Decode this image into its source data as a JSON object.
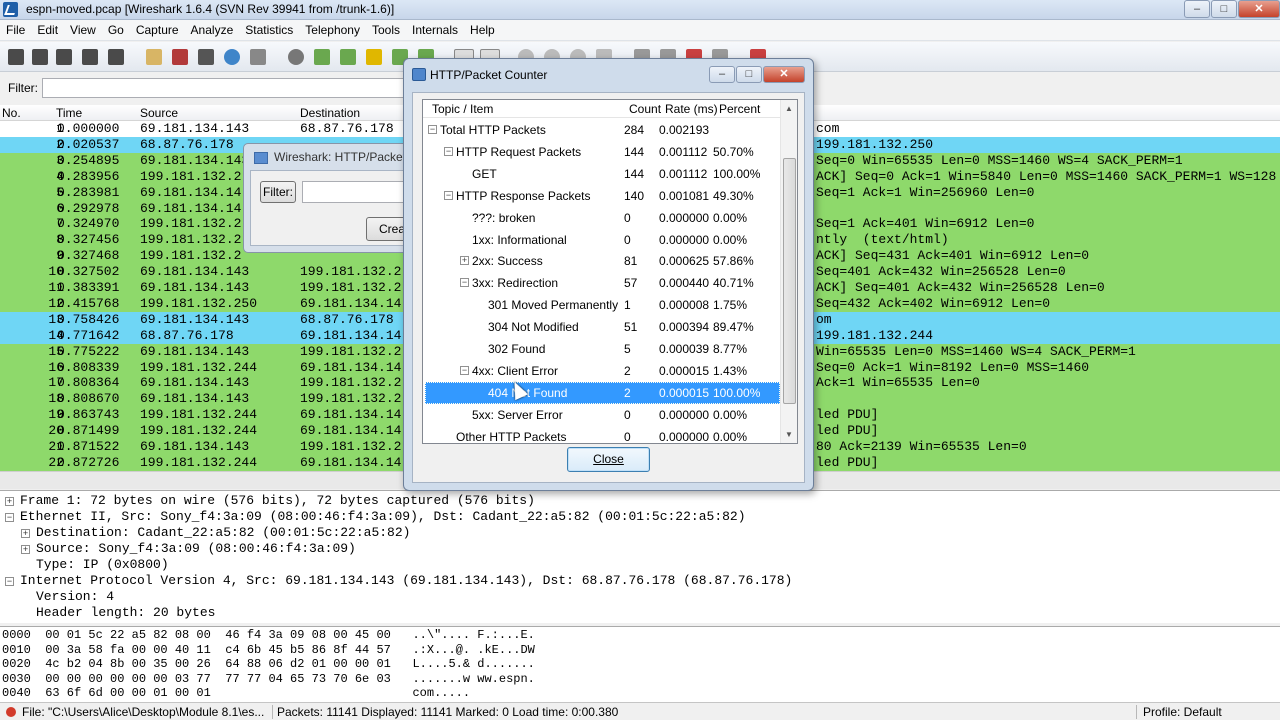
{
  "window": {
    "title": "espn-moved.pcap   [Wireshark 1.6.4  (SVN Rev 39941 from /trunk-1.6)]"
  },
  "menu": [
    "File",
    "Edit",
    "View",
    "Go",
    "Capture",
    "Analyze",
    "Statistics",
    "Telephony",
    "Tools",
    "Internals",
    "Help"
  ],
  "filter": {
    "label": "Filter:",
    "value": ""
  },
  "packet_list": {
    "columns": [
      "No.",
      "Time",
      "Source",
      "Destination"
    ],
    "rows": [
      {
        "no": "1",
        "time": "0.000000",
        "src": "69.181.134.143",
        "dst": "68.87.76.178",
        "info": "com",
        "color": "white"
      },
      {
        "no": "2",
        "time": "0.020537",
        "src": "68.87.76.178",
        "dst": "",
        "info": "199.181.132.250",
        "color": "blue"
      },
      {
        "no": "3",
        "time": "0.254895",
        "src": "69.181.134.143",
        "dst": "",
        "info": "Seq=0 Win=65535 Len=0 MSS=1460 WS=4 SACK_PERM=1",
        "color": "green"
      },
      {
        "no": "4",
        "time": "0.283956",
        "src": "199.181.132.2",
        "dst": "",
        "info": "ACK] Seq=0 Ack=1 Win=5840 Len=0 MSS=1460 SACK_PERM=1 WS=128",
        "color": "green"
      },
      {
        "no": "5",
        "time": "0.283981",
        "src": "69.181.134.14",
        "dst": "",
        "info": "Seq=1 Ack=1 Win=256960 Len=0",
        "color": "green"
      },
      {
        "no": "6",
        "time": "0.292978",
        "src": "69.181.134.14",
        "dst": "",
        "info": "",
        "color": "green"
      },
      {
        "no": "7",
        "time": "0.324970",
        "src": "199.181.132.2",
        "dst": "",
        "info": "Seq=1 Ack=401 Win=6912 Len=0",
        "color": "green"
      },
      {
        "no": "8",
        "time": "0.327456",
        "src": "199.181.132.2",
        "dst": "",
        "info": "ntly  (text/html)",
        "color": "green"
      },
      {
        "no": "9",
        "time": "0.327468",
        "src": "199.181.132.2",
        "dst": "",
        "info": "ACK] Seq=431 Ack=401 Win=6912 Len=0",
        "color": "green"
      },
      {
        "no": "10",
        "time": "0.327502",
        "src": "69.181.134.143",
        "dst": "199.181.132.2",
        "info": "Seq=401 Ack=432 Win=256528 Len=0",
        "color": "green"
      },
      {
        "no": "11",
        "time": "0.383391",
        "src": "69.181.134.143",
        "dst": "199.181.132.2",
        "info": "ACK] Seq=401 Ack=432 Win=256528 Len=0",
        "color": "green"
      },
      {
        "no": "12",
        "time": "0.415768",
        "src": "199.181.132.250",
        "dst": "69.181.134.14",
        "info": "Seq=432 Ack=402 Win=6912 Len=0",
        "color": "green"
      },
      {
        "no": "13",
        "time": "0.758426",
        "src": "69.181.134.143",
        "dst": "68.87.76.178",
        "info": "om",
        "color": "blue"
      },
      {
        "no": "14",
        "time": "0.771642",
        "src": "68.87.76.178",
        "dst": "69.181.134.14",
        "info": "199.181.132.244",
        "color": "blue"
      },
      {
        "no": "15",
        "time": "0.775222",
        "src": "69.181.134.143",
        "dst": "199.181.132.2",
        "info": "Win=65535 Len=0 MSS=1460 WS=4 SACK_PERM=1",
        "color": "green"
      },
      {
        "no": "16",
        "time": "0.808339",
        "src": "199.181.132.244",
        "dst": "69.181.134.14",
        "info": "Seq=0 Ack=1 Win=8192 Len=0 MSS=1460",
        "color": "green"
      },
      {
        "no": "17",
        "time": "0.808364",
        "src": "69.181.134.143",
        "dst": "199.181.132.2",
        "info": "Ack=1 Win=65535 Len=0",
        "color": "green"
      },
      {
        "no": "18",
        "time": "0.808670",
        "src": "69.181.134.143",
        "dst": "199.181.132.2",
        "info": "",
        "color": "green"
      },
      {
        "no": "19",
        "time": "0.863743",
        "src": "199.181.132.244",
        "dst": "69.181.134.14",
        "info": "led PDU]",
        "color": "green"
      },
      {
        "no": "20",
        "time": "0.871499",
        "src": "199.181.132.244",
        "dst": "69.181.134.14",
        "info": "led PDU]",
        "color": "green"
      },
      {
        "no": "21",
        "time": "0.871522",
        "src": "69.181.134.143",
        "dst": "199.181.132.2",
        "info": "80 Ack=2139 Win=65535 Len=0",
        "color": "green"
      },
      {
        "no": "22",
        "time": "0.872726",
        "src": "199.181.132.244",
        "dst": "69.181.134.14",
        "info": "led PDU]",
        "color": "green"
      }
    ]
  },
  "details": [
    {
      "indent": 0,
      "exp": "+",
      "text": "Frame 1: 72 bytes on wire (576 bits), 72 bytes captured (576 bits)"
    },
    {
      "indent": 0,
      "exp": "-",
      "text": "Ethernet II, Src: Sony_f4:3a:09 (08:00:46:f4:3a:09), Dst: Cadant_22:a5:82 (00:01:5c:22:a5:82)"
    },
    {
      "indent": 1,
      "exp": "+",
      "text": "Destination: Cadant_22:a5:82 (00:01:5c:22:a5:82)"
    },
    {
      "indent": 1,
      "exp": "+",
      "text": "Source: Sony_f4:3a:09 (08:00:46:f4:3a:09)"
    },
    {
      "indent": 1,
      "exp": "",
      "text": "Type: IP (0x0800)"
    },
    {
      "indent": 0,
      "exp": "-",
      "text": "Internet Protocol Version 4, Src: 69.181.134.143 (69.181.134.143), Dst: 68.87.76.178 (68.87.76.178)"
    },
    {
      "indent": 1,
      "exp": "",
      "text": "Version: 4"
    },
    {
      "indent": 1,
      "exp": "",
      "text": "Header length: 20 bytes"
    }
  ],
  "hex": [
    "0000  00 01 5c 22 a5 82 08 00  46 f4 3a 09 08 00 45 00   ..\\\".... F.:...E.",
    "0010  00 3a 58 fa 00 00 40 11  c4 6b 45 b5 86 8f 44 57   .:X...@. .kE...DW",
    "0020  4c b2 04 8b 00 35 00 26  64 88 06 d2 01 00 00 01   L....5.& d.......",
    "0030  00 00 00 00 00 00 03 77  77 77 04 65 73 70 6e 03   .......w ww.espn.",
    "0040  63 6f 6d 00 00 01 00 01                            com....."
  ],
  "status": {
    "file": "File: \"C:\\Users\\Alice\\Desktop\\Module 8.1\\es...",
    "packets": "Packets: 11141 Displayed: 11141 Marked: 0 Load time: 0:00.380",
    "profile": "Profile: Default"
  },
  "bg_dialog": {
    "title": "Wireshark: HTTP/Packet",
    "filter_button": "Filter:",
    "create_button": "Crea"
  },
  "dialog": {
    "title": "HTTP/Packet Counter",
    "columns": [
      "Topic / Item",
      "Count",
      "Rate (ms)",
      "Percent"
    ],
    "rows": [
      {
        "level": 0,
        "exp": "-",
        "label": "Total HTTP Packets",
        "count": "284",
        "rate": "0.002193",
        "percent": "",
        "selected": false
      },
      {
        "level": 1,
        "exp": "-",
        "label": "HTTP Request Packets",
        "count": "144",
        "rate": "0.001112",
        "percent": "50.70%",
        "selected": false
      },
      {
        "level": 2,
        "exp": "",
        "label": "GET",
        "count": "144",
        "rate": "0.001112",
        "percent": "100.00%",
        "selected": false
      },
      {
        "level": 1,
        "exp": "-",
        "label": "HTTP Response Packets",
        "count": "140",
        "rate": "0.001081",
        "percent": "49.30%",
        "selected": false
      },
      {
        "level": 2,
        "exp": "",
        "label": "???: broken",
        "count": "0",
        "rate": "0.000000",
        "percent": "0.00%",
        "selected": false
      },
      {
        "level": 2,
        "exp": "",
        "label": "1xx: Informational",
        "count": "0",
        "rate": "0.000000",
        "percent": "0.00%",
        "selected": false
      },
      {
        "level": 2,
        "exp": "+",
        "label": "2xx: Success",
        "count": "81",
        "rate": "0.000625",
        "percent": "57.86%",
        "selected": false
      },
      {
        "level": 2,
        "exp": "-",
        "label": "3xx: Redirection",
        "count": "57",
        "rate": "0.000440",
        "percent": "40.71%",
        "selected": false
      },
      {
        "level": 3,
        "exp": "",
        "label": "301 Moved Permanently",
        "count": "1",
        "rate": "0.000008",
        "percent": "1.75%",
        "selected": false
      },
      {
        "level": 3,
        "exp": "",
        "label": "304 Not Modified",
        "count": "51",
        "rate": "0.000394",
        "percent": "89.47%",
        "selected": false
      },
      {
        "level": 3,
        "exp": "",
        "label": "302 Found",
        "count": "5",
        "rate": "0.000039",
        "percent": "8.77%",
        "selected": false
      },
      {
        "level": 2,
        "exp": "-",
        "label": "4xx: Client Error",
        "count": "2",
        "rate": "0.000015",
        "percent": "1.43%",
        "selected": false
      },
      {
        "level": 3,
        "exp": "",
        "label": "404 Not Found",
        "count": "2",
        "rate": "0.000015",
        "percent": "100.00%",
        "selected": true
      },
      {
        "level": 2,
        "exp": "",
        "label": "5xx: Server Error",
        "count": "0",
        "rate": "0.000000",
        "percent": "0.00%",
        "selected": false
      },
      {
        "level": 1,
        "exp": "",
        "label": "Other HTTP Packets",
        "count": "0",
        "rate": "0.000000",
        "percent": "0.00%",
        "selected": false
      }
    ],
    "close_label": "Close"
  },
  "icons": [
    "wireshark-icon",
    "minimize-icon",
    "maximize-icon",
    "close-icon",
    "expand-icon",
    "collapse-icon",
    "mouse-cursor-icon"
  ]
}
